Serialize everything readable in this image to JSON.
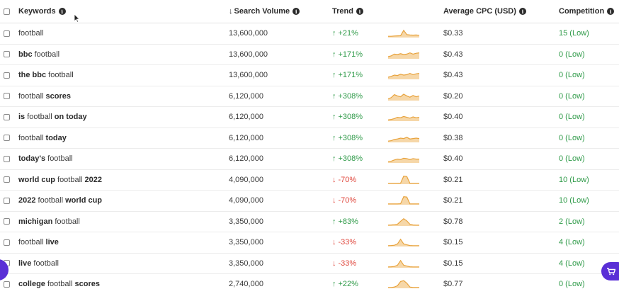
{
  "header": {
    "keywords": "Keywords",
    "search_volume": "Search Volume",
    "trend": "Trend",
    "cpc": "Average CPC (USD)",
    "competition": "Competition"
  },
  "rows": [
    {
      "kw": [
        {
          "t": "football",
          "b": false
        }
      ],
      "volume": "13,600,000",
      "trend": "+21%",
      "dir": "up",
      "cpc": "$0.33",
      "comp": "15 (Low)",
      "spark": [
        0.15,
        0.15,
        0.18,
        0.2,
        0.22,
        0.85,
        0.35,
        0.3,
        0.28,
        0.3,
        0.27
      ]
    },
    {
      "kw": [
        {
          "t": "bbc",
          "b": true
        },
        {
          "t": " football",
          "b": false
        }
      ],
      "volume": "13,600,000",
      "trend": "+171%",
      "dir": "up",
      "cpc": "$0.43",
      "comp": "0 (Low)",
      "spark": [
        0.25,
        0.35,
        0.55,
        0.5,
        0.6,
        0.5,
        0.55,
        0.7,
        0.55,
        0.65,
        0.7
      ]
    },
    {
      "kw": [
        {
          "t": "the bbc",
          "b": true
        },
        {
          "t": " football",
          "b": false
        }
      ],
      "volume": "13,600,000",
      "trend": "+171%",
      "dir": "up",
      "cpc": "$0.43",
      "comp": "0 (Low)",
      "spark": [
        0.25,
        0.35,
        0.5,
        0.45,
        0.6,
        0.5,
        0.55,
        0.7,
        0.55,
        0.65,
        0.7
      ]
    },
    {
      "kw": [
        {
          "t": "football",
          "b": false
        },
        {
          "t": " scores",
          "b": true
        }
      ],
      "volume": "6,120,000",
      "trend": "+308%",
      "dir": "up",
      "cpc": "$0.20",
      "comp": "0 (Low)",
      "spark": [
        0.2,
        0.35,
        0.7,
        0.55,
        0.45,
        0.75,
        0.55,
        0.4,
        0.6,
        0.45,
        0.55
      ]
    },
    {
      "kw": [
        {
          "t": "is",
          "b": true
        },
        {
          "t": " football ",
          "b": false
        },
        {
          "t": "on today",
          "b": true
        }
      ],
      "volume": "6,120,000",
      "trend": "+308%",
      "dir": "up",
      "cpc": "$0.40",
      "comp": "0 (Low)",
      "spark": [
        0.15,
        0.2,
        0.3,
        0.45,
        0.4,
        0.55,
        0.45,
        0.35,
        0.5,
        0.4,
        0.45
      ]
    },
    {
      "kw": [
        {
          "t": "football",
          "b": false
        },
        {
          "t": " today",
          "b": true
        }
      ],
      "volume": "6,120,000",
      "trend": "+308%",
      "dir": "up",
      "cpc": "$0.38",
      "comp": "0 (Low)",
      "spark": [
        0.15,
        0.2,
        0.35,
        0.4,
        0.5,
        0.45,
        0.6,
        0.4,
        0.45,
        0.5,
        0.45
      ]
    },
    {
      "kw": [
        {
          "t": "today's",
          "b": true
        },
        {
          "t": " football",
          "b": false
        }
      ],
      "volume": "6,120,000",
      "trend": "+308%",
      "dir": "up",
      "cpc": "$0.40",
      "comp": "0 (Low)",
      "spark": [
        0.15,
        0.2,
        0.35,
        0.45,
        0.4,
        0.55,
        0.5,
        0.4,
        0.5,
        0.45,
        0.45
      ]
    },
    {
      "kw": [
        {
          "t": "world cup",
          "b": true
        },
        {
          "t": " football ",
          "b": false
        },
        {
          "t": "2022",
          "b": true
        }
      ],
      "volume": "4,090,000",
      "trend": "-70%",
      "dir": "down",
      "cpc": "$0.21",
      "comp": "10 (Low)",
      "spark": [
        0.1,
        0.1,
        0.1,
        0.1,
        0.12,
        0.95,
        0.9,
        0.1,
        0.1,
        0.1,
        0.1
      ]
    },
    {
      "kw": [
        {
          "t": "2022",
          "b": true
        },
        {
          "t": " football ",
          "b": false
        },
        {
          "t": "world cup",
          "b": true
        }
      ],
      "volume": "4,090,000",
      "trend": "-70%",
      "dir": "down",
      "cpc": "$0.21",
      "comp": "10 (Low)",
      "spark": [
        0.1,
        0.1,
        0.1,
        0.1,
        0.12,
        0.95,
        0.9,
        0.1,
        0.1,
        0.1,
        0.1
      ]
    },
    {
      "kw": [
        {
          "t": "michigan",
          "b": true
        },
        {
          "t": " football",
          "b": false
        }
      ],
      "volume": "3,350,000",
      "trend": "+83%",
      "dir": "up",
      "cpc": "$0.78",
      "comp": "2 (Low)",
      "spark": [
        0.1,
        0.12,
        0.15,
        0.2,
        0.55,
        0.85,
        0.6,
        0.2,
        0.12,
        0.1,
        0.1
      ]
    },
    {
      "kw": [
        {
          "t": "football",
          "b": false
        },
        {
          "t": " live",
          "b": true
        }
      ],
      "volume": "3,350,000",
      "trend": "-33%",
      "dir": "down",
      "cpc": "$0.15",
      "comp": "4 (Low)",
      "spark": [
        0.1,
        0.12,
        0.15,
        0.3,
        0.85,
        0.3,
        0.2,
        0.12,
        0.1,
        0.1,
        0.1
      ]
    },
    {
      "kw": [
        {
          "t": "live",
          "b": true
        },
        {
          "t": " football",
          "b": false
        }
      ],
      "volume": "3,350,000",
      "trend": "-33%",
      "dir": "down",
      "cpc": "$0.15",
      "comp": "4 (Low)",
      "spark": [
        0.1,
        0.12,
        0.15,
        0.3,
        0.85,
        0.3,
        0.2,
        0.12,
        0.1,
        0.1,
        0.1
      ]
    },
    {
      "kw": [
        {
          "t": "college",
          "b": true
        },
        {
          "t": " football ",
          "b": false
        },
        {
          "t": "scores",
          "b": true
        }
      ],
      "volume": "2,740,000",
      "trend": "+22%",
      "dir": "up",
      "cpc": "$0.77",
      "comp": "0 (Low)",
      "spark": [
        0.1,
        0.1,
        0.15,
        0.3,
        0.8,
        0.9,
        0.6,
        0.15,
        0.1,
        0.1,
        0.1
      ]
    }
  ],
  "colors": {
    "up": "#2e9a48",
    "down": "#e0483e",
    "spark_line": "#e8a33d",
    "spark_fill": "#f6d7a8",
    "accent": "#5a2fd6"
  },
  "icons": {
    "info": "info-icon",
    "sort": "arrow-down-icon",
    "up": "arrow-up-icon",
    "down": "arrow-down-icon",
    "cart": "cart-icon"
  }
}
